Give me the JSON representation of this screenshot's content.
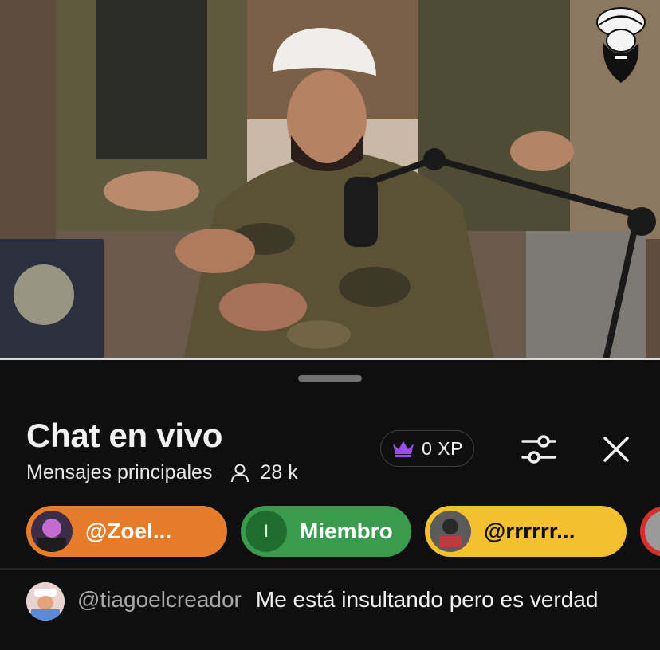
{
  "video": {
    "channel_logo_icon": "turban-bearded-man-logo"
  },
  "chat": {
    "title": "Chat en vivo",
    "mode_label": "Mensajes principales",
    "viewer_count": "28 k",
    "viewers_icon": "person-icon",
    "xp": {
      "icon": "crown-icon",
      "value": "0 XP"
    },
    "filter_icon": "sliders-icon",
    "close_icon": "close-icon",
    "chips": [
      {
        "label": "@Zoel...",
        "color": "#e67c2a"
      },
      {
        "label": "Miembro",
        "avatar_letter": "I",
        "color": "#3a9b4f"
      },
      {
        "label": "@rrrrrr...",
        "color": "#f3c12f"
      },
      {
        "label": "",
        "color": "#d4302b"
      }
    ],
    "messages": [
      {
        "author": "@tiagoelcreador",
        "text": "Me está insultando pero es verdad"
      }
    ]
  }
}
